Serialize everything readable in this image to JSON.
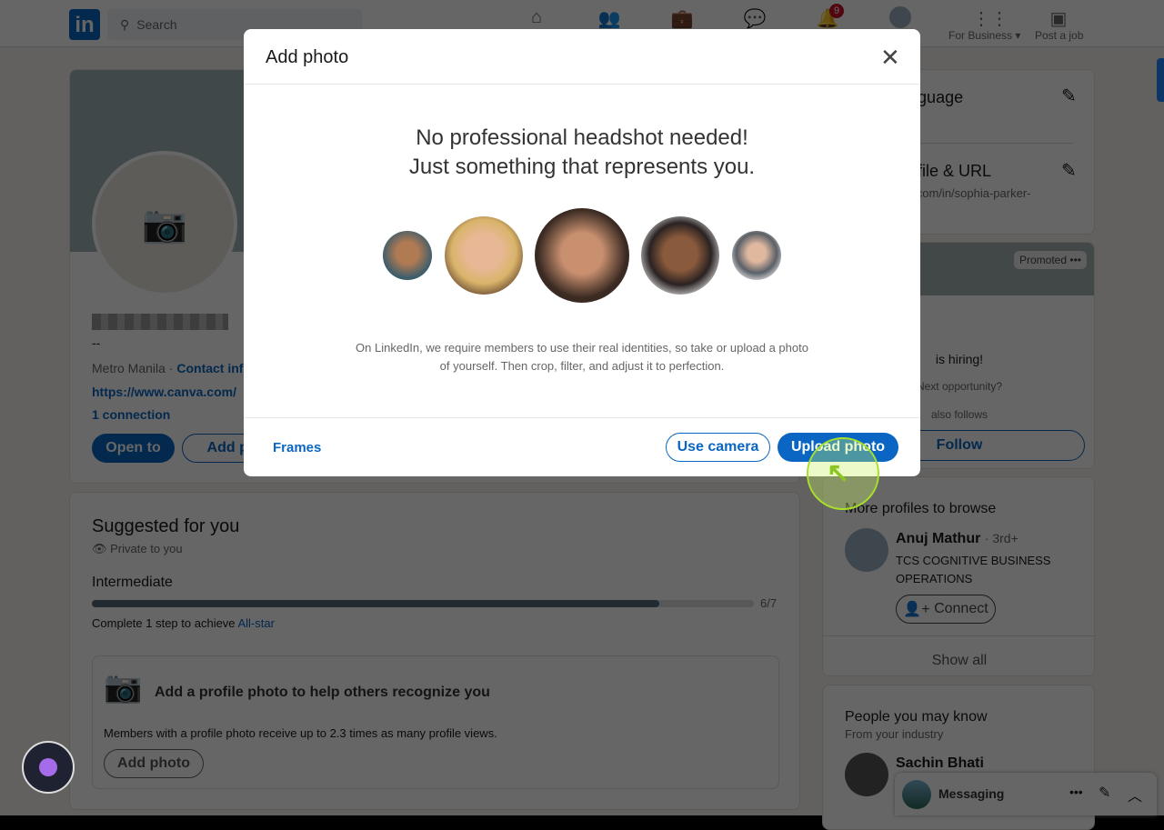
{
  "header": {
    "search_placeholder": "Search",
    "notifications_count": "9",
    "for_business": "For Business ▾",
    "post_job": "Post a job"
  },
  "profile": {
    "location": "Metro Manila ·",
    "contact_info": "Contact info",
    "website": "https://www.canva.com/",
    "connections": "1 connection",
    "headline": "--",
    "open_to": "Open to",
    "add_profile": "Add profile section"
  },
  "right_panel": {
    "language": "Profile language",
    "public_profile": "Public profile & URL",
    "profile_url": "www.linkedin.com/in/sophia-parker-",
    "promoted": "Promoted",
    "hiring": "is hiring!",
    "opportunity": "Next opportunity?",
    "also_follows": "also follows",
    "follow": "Follow"
  },
  "suggested": {
    "title": "Suggested for you",
    "privacy": "Private to you",
    "level": "Intermediate",
    "progress": "6/7",
    "progress_value": 0.857,
    "complete_prefix": "Complete 1 step to achieve",
    "all_star": "All-star",
    "photo_title": "Add a profile photo to help others recognize you",
    "photo_desc": "Members with a profile photo receive up to 2.3 times as many profile views.",
    "add_photo": "Add photo"
  },
  "more_profiles": {
    "title": "More profiles to browse",
    "name": "Anuj Mathur",
    "degree": "· 3rd+",
    "company": "TCS COGNITIVE BUSINESS OPERATIONS",
    "connect": "Connect",
    "show_all": "Show all"
  },
  "people": {
    "title": "People you may know",
    "subtitle": "From your industry",
    "name": "Sachin Bhati"
  },
  "messaging": {
    "label": "Messaging"
  },
  "modal": {
    "title": "Add photo",
    "headline1": "No professional headshot needed!",
    "headline2": "Just something that represents you.",
    "description": "On LinkedIn, we require members to use their real identities, so take or upload a photo of yourself. Then crop, filter, and adjust it to perfection.",
    "frames": "Frames",
    "use_camera": "Use camera",
    "upload_photo": "Upload photo"
  },
  "colors": {
    "brand": "#0a66c2",
    "highlight": "#a8e02a"
  }
}
